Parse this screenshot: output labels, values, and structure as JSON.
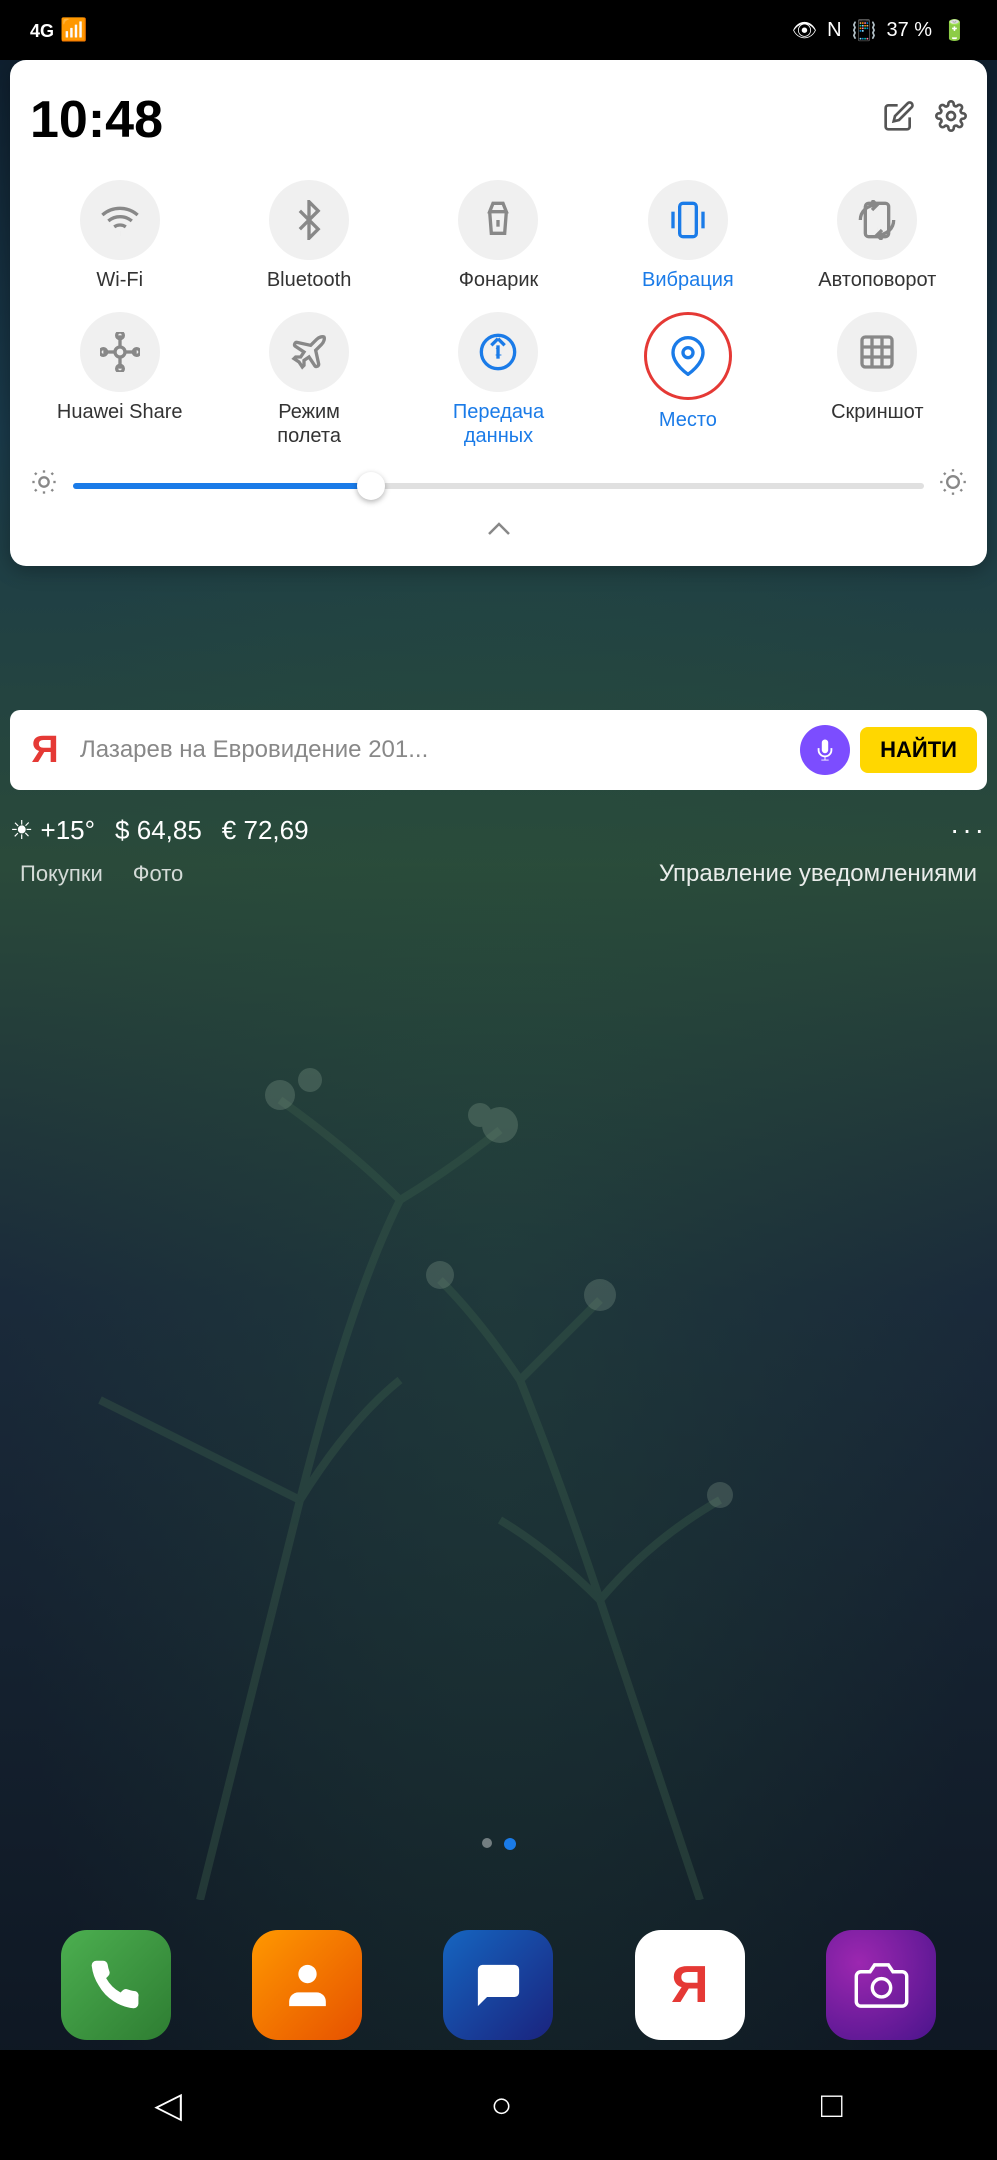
{
  "status_bar": {
    "signal": "4G",
    "battery": "37 %",
    "icons": [
      "eye-icon",
      "nfc-icon",
      "vibrate-icon"
    ]
  },
  "quick_panel": {
    "time": "10:48",
    "header_icons": {
      "edit_label": "✏",
      "settings_label": "⚙"
    },
    "toggles": [
      {
        "id": "wifi",
        "icon": "wifi",
        "label": "Wi-Fi",
        "active": false
      },
      {
        "id": "bluetooth",
        "icon": "bluetooth",
        "label": "Bluetooth",
        "active": false
      },
      {
        "id": "flashlight",
        "icon": "flashlight",
        "label": "Фонарик",
        "active": false
      },
      {
        "id": "vibration",
        "icon": "vibration",
        "label": "Вибрация",
        "active": true
      },
      {
        "id": "autorotate",
        "icon": "autorotate",
        "label": "Автоповорот",
        "active": false
      },
      {
        "id": "huawei_share",
        "icon": "huawei_share",
        "label": "Huawei Share",
        "active": false
      },
      {
        "id": "airplane",
        "icon": "airplane",
        "label": "Режим полета",
        "active": false
      },
      {
        "id": "data_transfer",
        "icon": "data_transfer",
        "label": "Передача данных",
        "active": true
      },
      {
        "id": "location",
        "icon": "location",
        "label": "Место",
        "active": true,
        "highlighted": true
      },
      {
        "id": "screenshot",
        "icon": "screenshot",
        "label": "Скриншот",
        "active": false
      }
    ],
    "brightness": {
      "level": 35
    },
    "collapse_arrow": "∧"
  },
  "search_bar": {
    "logo": "Я",
    "placeholder": "Лазарев на Евровидение 201...",
    "mic_label": "🎤",
    "find_label": "НАЙТИ"
  },
  "info_bar": {
    "weather": "☀ +15°",
    "dollar": "$ 64,85",
    "euro": "€ 72,69",
    "dots": "···"
  },
  "shortcuts": {
    "items": [
      "Покупки",
      "Фото"
    ],
    "notification": "Управление уведомлениями"
  },
  "dock": {
    "apps": [
      {
        "id": "phone",
        "icon": "📞",
        "color": "green"
      },
      {
        "id": "contacts",
        "icon": "👤",
        "color": "orange"
      },
      {
        "id": "messages",
        "icon": "💬",
        "color": "blue"
      },
      {
        "id": "yandex",
        "icon": "Я",
        "color": "red"
      },
      {
        "id": "camera",
        "icon": "📷",
        "color": "purple"
      }
    ]
  },
  "navigation": {
    "back": "◁",
    "home": "○",
    "recent": "□"
  },
  "page_dots": [
    {
      "active": false
    },
    {
      "active": true
    }
  ]
}
